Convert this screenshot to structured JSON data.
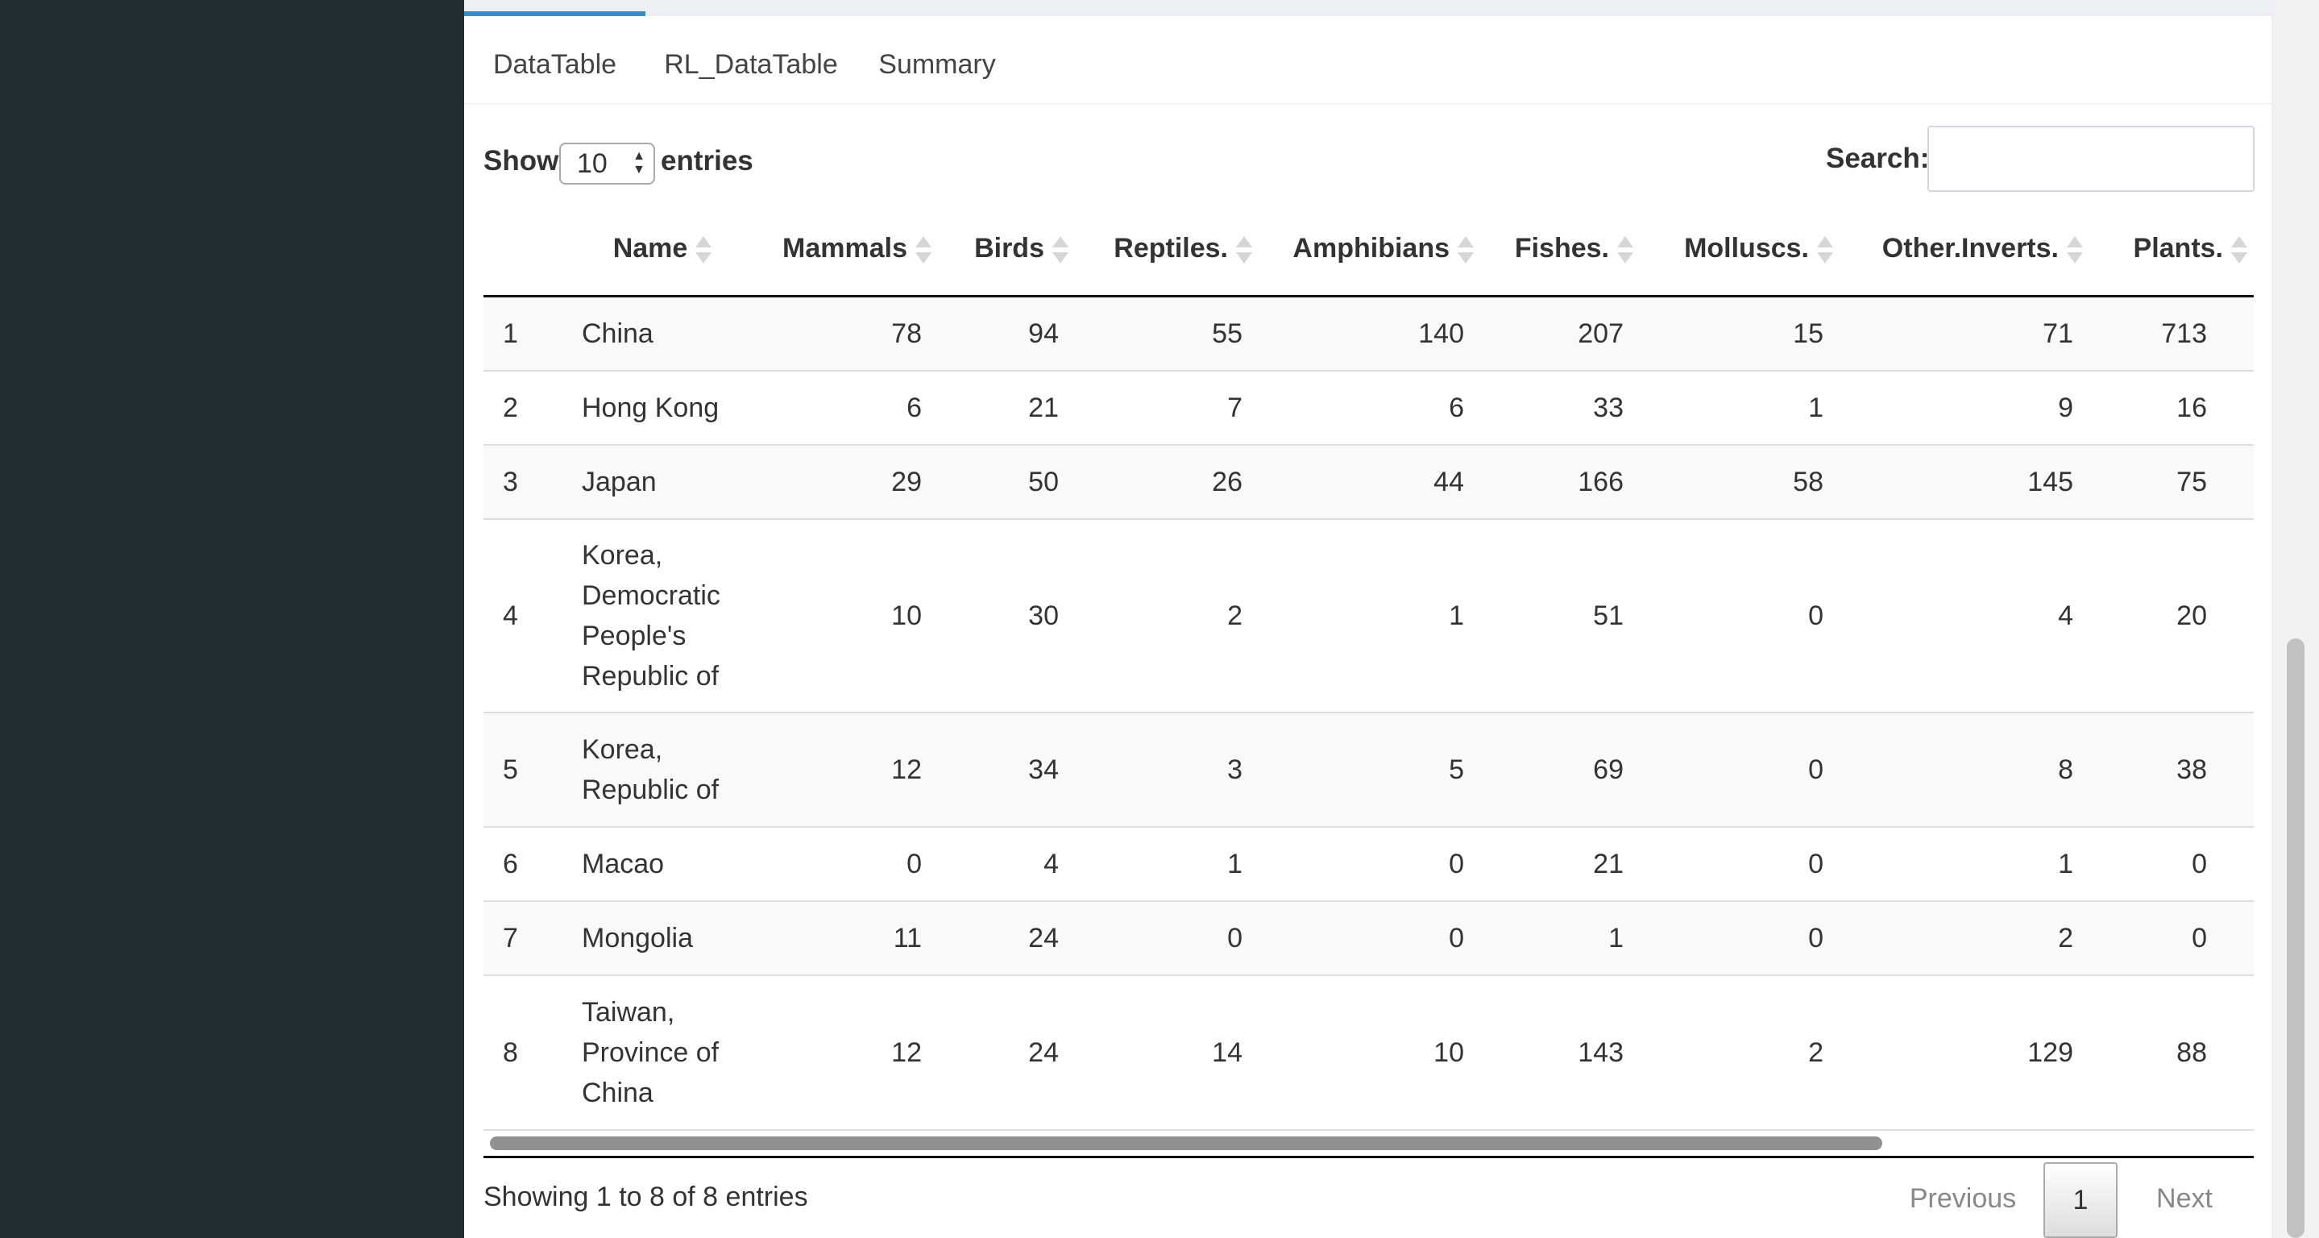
{
  "tabs": [
    "DataTable",
    "RL_DataTable",
    "Summary"
  ],
  "length": {
    "show_label": "Show",
    "value": "10",
    "entries_label": "entries"
  },
  "search": {
    "label": "Search:",
    "value": ""
  },
  "columns": [
    "",
    "Name",
    "Mammals",
    "Birds",
    "Reptiles.",
    "Amphibians",
    "Fishes.",
    "Molluscs.",
    "Other.Inverts.",
    "Plants."
  ],
  "rows": [
    {
      "idx": "1",
      "name": "China",
      "v": [
        "78",
        "94",
        "55",
        "140",
        "207",
        "15",
        "71",
        "713"
      ]
    },
    {
      "idx": "2",
      "name": "Hong Kong",
      "v": [
        "6",
        "21",
        "7",
        "6",
        "33",
        "1",
        "9",
        "16"
      ]
    },
    {
      "idx": "3",
      "name": "Japan",
      "v": [
        "29",
        "50",
        "26",
        "44",
        "166",
        "58",
        "145",
        "75"
      ]
    },
    {
      "idx": "4",
      "name": "Korea, Democratic People's Republic of",
      "v": [
        "10",
        "30",
        "2",
        "1",
        "51",
        "0",
        "4",
        "20"
      ]
    },
    {
      "idx": "5",
      "name": "Korea, Republic of",
      "v": [
        "12",
        "34",
        "3",
        "5",
        "69",
        "0",
        "8",
        "38"
      ]
    },
    {
      "idx": "6",
      "name": "Macao",
      "v": [
        "0",
        "4",
        "1",
        "0",
        "21",
        "0",
        "1",
        "0"
      ]
    },
    {
      "idx": "7",
      "name": "Mongolia",
      "v": [
        "11",
        "24",
        "0",
        "0",
        "1",
        "0",
        "2",
        "0"
      ]
    },
    {
      "idx": "8",
      "name": "Taiwan, Province of China",
      "v": [
        "12",
        "24",
        "14",
        "10",
        "143",
        "2",
        "129",
        "88"
      ]
    }
  ],
  "info": "Showing 1 to 8 of 8 entries",
  "pager": {
    "previous": "Previous",
    "current": "1",
    "next": "Next"
  }
}
